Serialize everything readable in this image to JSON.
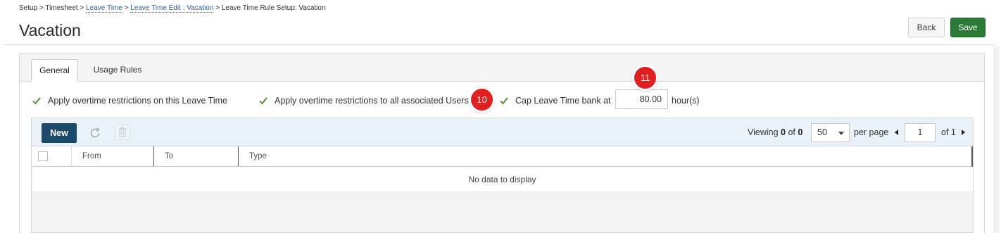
{
  "breadcrumb": {
    "item1": "Setup",
    "sep": ">",
    "item2": "Timesheet",
    "item3": "Leave Time",
    "item4": "Leave Time Edit : Vacation",
    "item5": "Leave Time Rule Setup: Vacation"
  },
  "page": {
    "title": "Vacation"
  },
  "header_buttons": {
    "back": "Back",
    "save": "Save"
  },
  "tabs": [
    {
      "label": "General",
      "active": true
    },
    {
      "label": "Usage Rules",
      "active": false
    }
  ],
  "options": {
    "opt1": "Apply overtime restrictions on this Leave Time",
    "opt2": "Apply overtime restrictions to all associated Users",
    "opt3": "Cap Leave Time bank at",
    "cap_value": "80.00",
    "cap_unit": "hour(s)"
  },
  "annotations": {
    "badge_a": "10",
    "badge_b": "11"
  },
  "grid": {
    "new_label": "New",
    "viewing_label": "Viewing",
    "viewing_count": "0",
    "of_label": "of",
    "viewing_total": "0",
    "page_size": "50",
    "per_page_label": "per page",
    "current_page": "1",
    "page_total_label": "of 1",
    "columns": [
      "From",
      "To",
      "Type"
    ],
    "empty_message": "No data to display"
  },
  "colors": {
    "save_green": "#2b7a38",
    "new_navy": "#1c4a6b",
    "badge_red": "#e02020",
    "link_blue": "#2a6496",
    "check_green": "#4a8a2a"
  },
  "icons": [
    "check-icon",
    "refresh-icon",
    "trash-icon",
    "prev-page-icon",
    "next-page-icon",
    "dropdown-caret-icon"
  ]
}
